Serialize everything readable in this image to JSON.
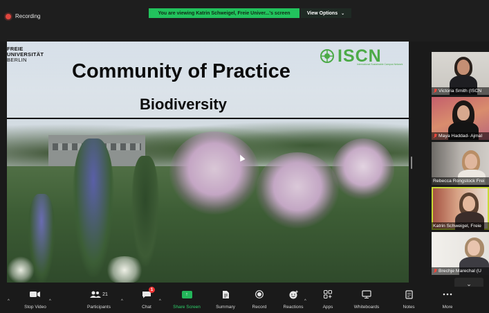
{
  "recording": {
    "label": "Recording",
    "color": "#e0463e"
  },
  "banner": {
    "viewing_text": "You are viewing Katrin Schweigel, Freie Univer...'s screen",
    "view_options_label": "View Options",
    "chevron_icon": "chevron-down-icon",
    "color": "#22c35d"
  },
  "slide": {
    "university_logo": [
      "FREIE",
      "UNIVERSITÄT",
      "BERLIN"
    ],
    "org_logo": "ISCN",
    "org_tagline": "International Sustainable Campus Network",
    "title": "Community of Practice",
    "subtitle": "Biodiversity",
    "brand_color": "#4caa47"
  },
  "participants": [
    {
      "name": "Victoria Smith (ISCN",
      "muted": true,
      "active": false
    },
    {
      "name": "Maya Haddad- Ajmal",
      "muted": true,
      "active": false
    },
    {
      "name": "Rebecca Rongstock Frei",
      "muted": false,
      "active": false
    },
    {
      "name": "Katrin Schweigel, Freie",
      "muted": false,
      "active": true
    },
    {
      "name": "Brechje Marechal (U",
      "muted": true,
      "active": false
    }
  ],
  "toolbar": {
    "stop_video": "Stop Video",
    "participants": "Participants",
    "participants_count": "21",
    "chat": "Chat",
    "chat_badge": "1",
    "share_screen": "Share Screen",
    "summary": "Summary",
    "record": "Record",
    "reactions": "Reactions",
    "apps": "Apps",
    "whiteboards": "Whiteboards",
    "notes": "Notes",
    "more": "More",
    "active_color": "#2fd16a"
  }
}
